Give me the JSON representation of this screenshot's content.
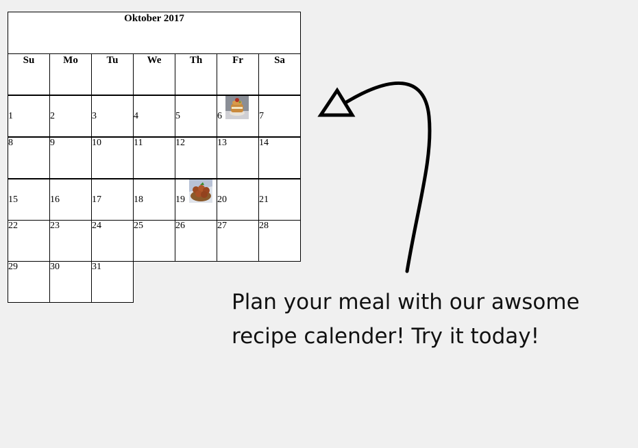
{
  "calendar": {
    "title": "Oktober 2017",
    "weekdays": [
      "Su",
      "Mo",
      "Tu",
      "We",
      "Th",
      "Fr",
      "Sa"
    ],
    "weeks": [
      [
        "1",
        "2",
        "3",
        "4",
        "5",
        "6",
        "7"
      ],
      [
        "8",
        "9",
        "10",
        "11",
        "12",
        "13",
        "14"
      ],
      [
        "15",
        "16",
        "17",
        "18",
        "19",
        "20",
        "21"
      ],
      [
        "22",
        "23",
        "24",
        "25",
        "26",
        "27",
        "28"
      ],
      [
        "29",
        "30",
        "31"
      ]
    ],
    "recipe_days": [
      "6",
      "19"
    ]
  },
  "promo": {
    "line1": "Plan your meal with our awsome",
    "line2": "recipe calender! Try it today!"
  },
  "icons": {
    "arrow": "curved-arrow-icon",
    "recipe6": "dessert-photo-icon",
    "recipe19": "meatball-photo-icon"
  }
}
